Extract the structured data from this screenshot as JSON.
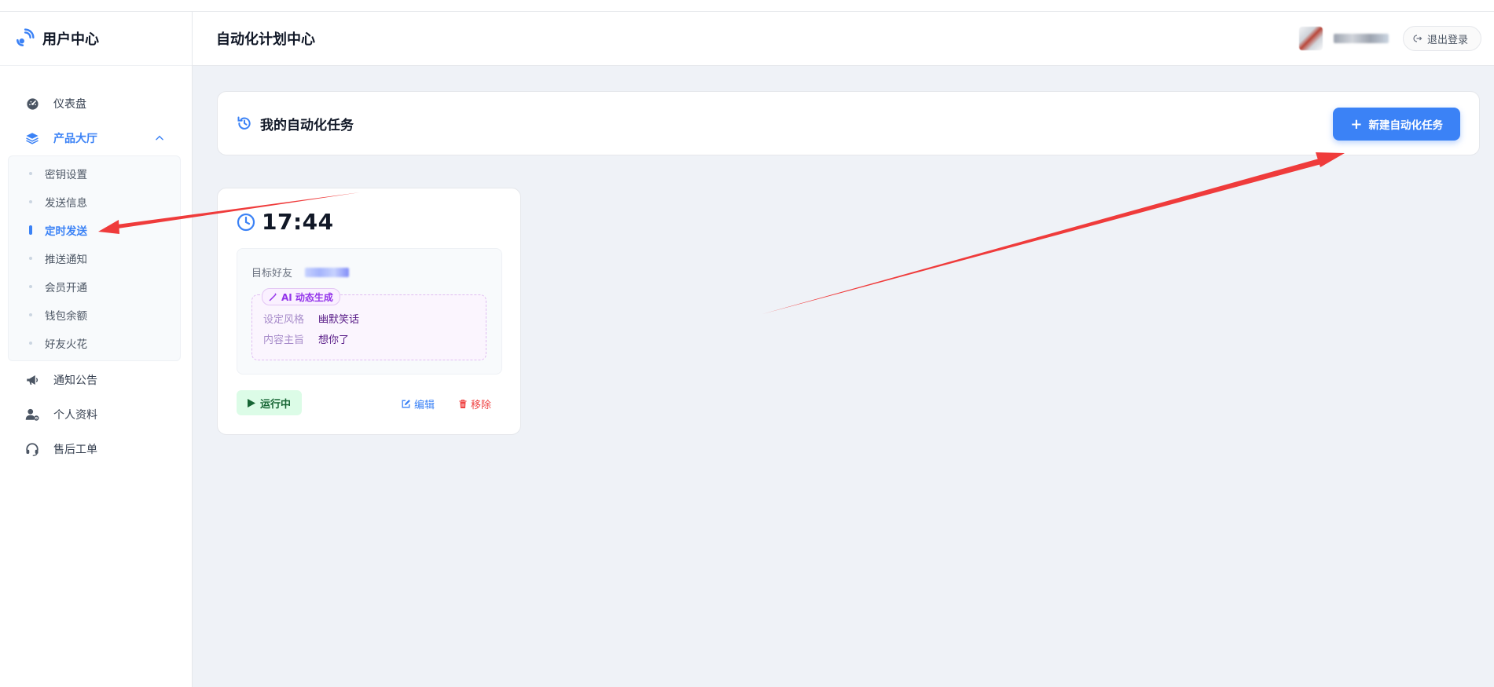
{
  "brand": {
    "title": "用户中心",
    "icon": "satellite-icon"
  },
  "sidebar": {
    "items": [
      {
        "label": "仪表盘",
        "icon": "dashboard-icon"
      },
      {
        "label": "产品大厅",
        "icon": "layers-icon",
        "expanded": true
      },
      {
        "label": "通知公告",
        "icon": "megaphone-icon"
      },
      {
        "label": "个人资料",
        "icon": "user-gear-icon"
      },
      {
        "label": "售后工单",
        "icon": "headset-icon"
      }
    ],
    "submenu": [
      {
        "label": "密钥设置"
      },
      {
        "label": "发送信息"
      },
      {
        "label": "定时发送",
        "active": true
      },
      {
        "label": "推送通知"
      },
      {
        "label": "会员开通"
      },
      {
        "label": "钱包余额"
      },
      {
        "label": "好友火花"
      }
    ]
  },
  "header": {
    "title": "自动化计划中心",
    "logout_label": "退出登录"
  },
  "main": {
    "section_title": "我的自动化任务",
    "new_button_label": "新建自动化任务",
    "task": {
      "time": "17:44",
      "target_label": "目标好友",
      "ai_badge": "AI 动态生成",
      "style_label": "设定风格",
      "style_value": "幽默笑话",
      "theme_label": "内容主旨",
      "theme_value": "想你了",
      "status": "运行中",
      "edit_label": "编辑",
      "remove_label": "移除"
    }
  },
  "colors": {
    "accent": "#3b82f6",
    "danger": "#ef4444",
    "success_bg": "#dcfce7",
    "annotation_arrow": "#ef3b3b",
    "ai_purple": "#9333ea"
  }
}
